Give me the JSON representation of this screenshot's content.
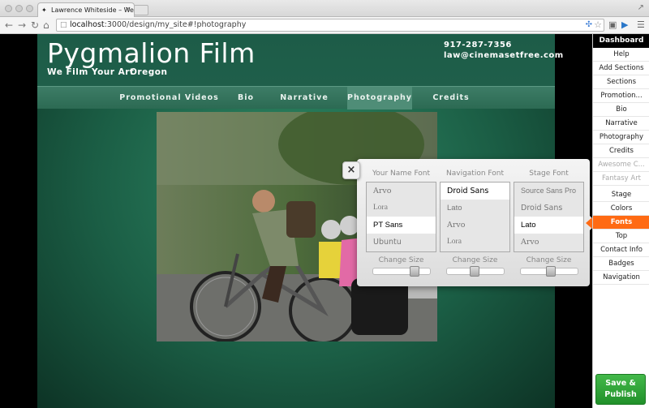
{
  "browser": {
    "tab_title": "Lawrence Whiteside – We F",
    "url_host": "localhost",
    "url_rest": ":3000/design/my_site#!photography"
  },
  "site": {
    "title": "Pygmalion Film",
    "tagline": "We Film Your Art",
    "location": "Oregon",
    "phone": "917-287-7356",
    "email": "law@cinemasetfree.com",
    "nav": [
      "Promotional Videos",
      "Bio",
      "Narrative",
      "Photography",
      "Credits"
    ],
    "active_nav": "Photography"
  },
  "font_panel": {
    "close_label": "×",
    "columns": [
      {
        "heading": "Your Name Font",
        "options": [
          "Arvo",
          "Lora",
          "PT Sans",
          "Ubuntu"
        ],
        "selected": "PT Sans",
        "size_label": "Change Size",
        "size_level": 0.8
      },
      {
        "heading": "Navigation Font",
        "options": [
          "Droid Sans",
          "Lato",
          "Arvo",
          "Lora"
        ],
        "selected": "Droid Sans",
        "size_label": "Change Size",
        "size_level": 0.5
      },
      {
        "heading": "Stage Font",
        "options": [
          "Source Sans Pro",
          "Droid Sans",
          "Lato",
          "Arvo"
        ],
        "selected": "Lato",
        "size_label": "Change Size",
        "size_level": 0.55
      }
    ]
  },
  "sidebar": {
    "dashboard": "Dashboard",
    "items": [
      "Help",
      "Add Sections",
      "Sections",
      "Promotion...",
      "Bio",
      "Narrative",
      "Photography",
      "Credits",
      "Awesome C...",
      "Fantasy Art",
      "Stage",
      "Colors",
      "Fonts",
      "Top",
      "Contact Info",
      "Badges",
      "Navigation"
    ],
    "dim_items": [
      "Awesome C...",
      "Fantasy Art"
    ],
    "active_item": "Fonts",
    "save_label": "Save &\nPublish"
  },
  "colors": {
    "accent": "#ff6a13",
    "save_green": "#2ea337",
    "stage_green": "#1b5e45"
  }
}
